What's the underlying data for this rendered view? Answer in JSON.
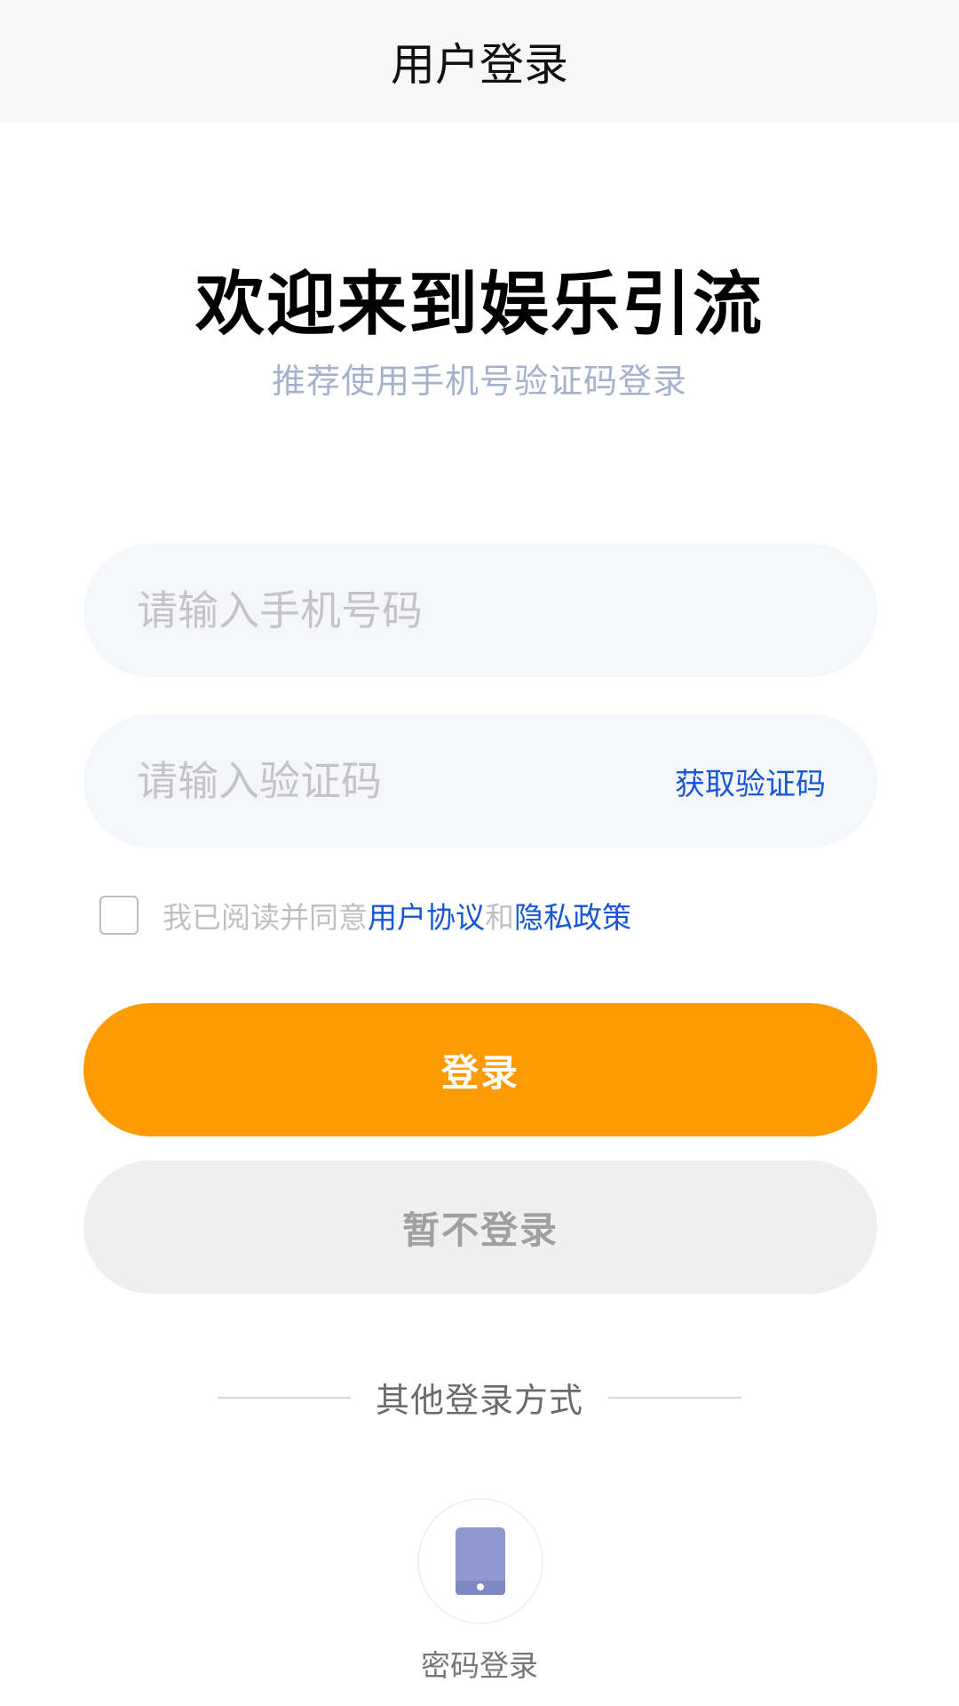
{
  "nav": {
    "title": "用户登录"
  },
  "welcome": {
    "title": "欢迎来到娱乐引流",
    "subtitle": "推荐使用手机号验证码登录"
  },
  "form": {
    "phone_placeholder": "请输入手机号码",
    "code_placeholder": "请输入验证码",
    "get_code_label": "获取验证码"
  },
  "agreement": {
    "prefix": "我已阅读并同意",
    "user_agreement": "用户协议",
    "and": "和",
    "privacy_policy": "隐私政策",
    "checked": false
  },
  "buttons": {
    "login": "登录",
    "skip": "暂不登录"
  },
  "other_login": {
    "title": "其他登录方式",
    "methods": [
      {
        "label": "密码登录",
        "icon": "phone-icon",
        "icon_color": "#8e98cf"
      }
    ]
  },
  "colors": {
    "accent": "#ff9b02",
    "link": "#1757d6",
    "subtitle": "#a6b2cc"
  }
}
